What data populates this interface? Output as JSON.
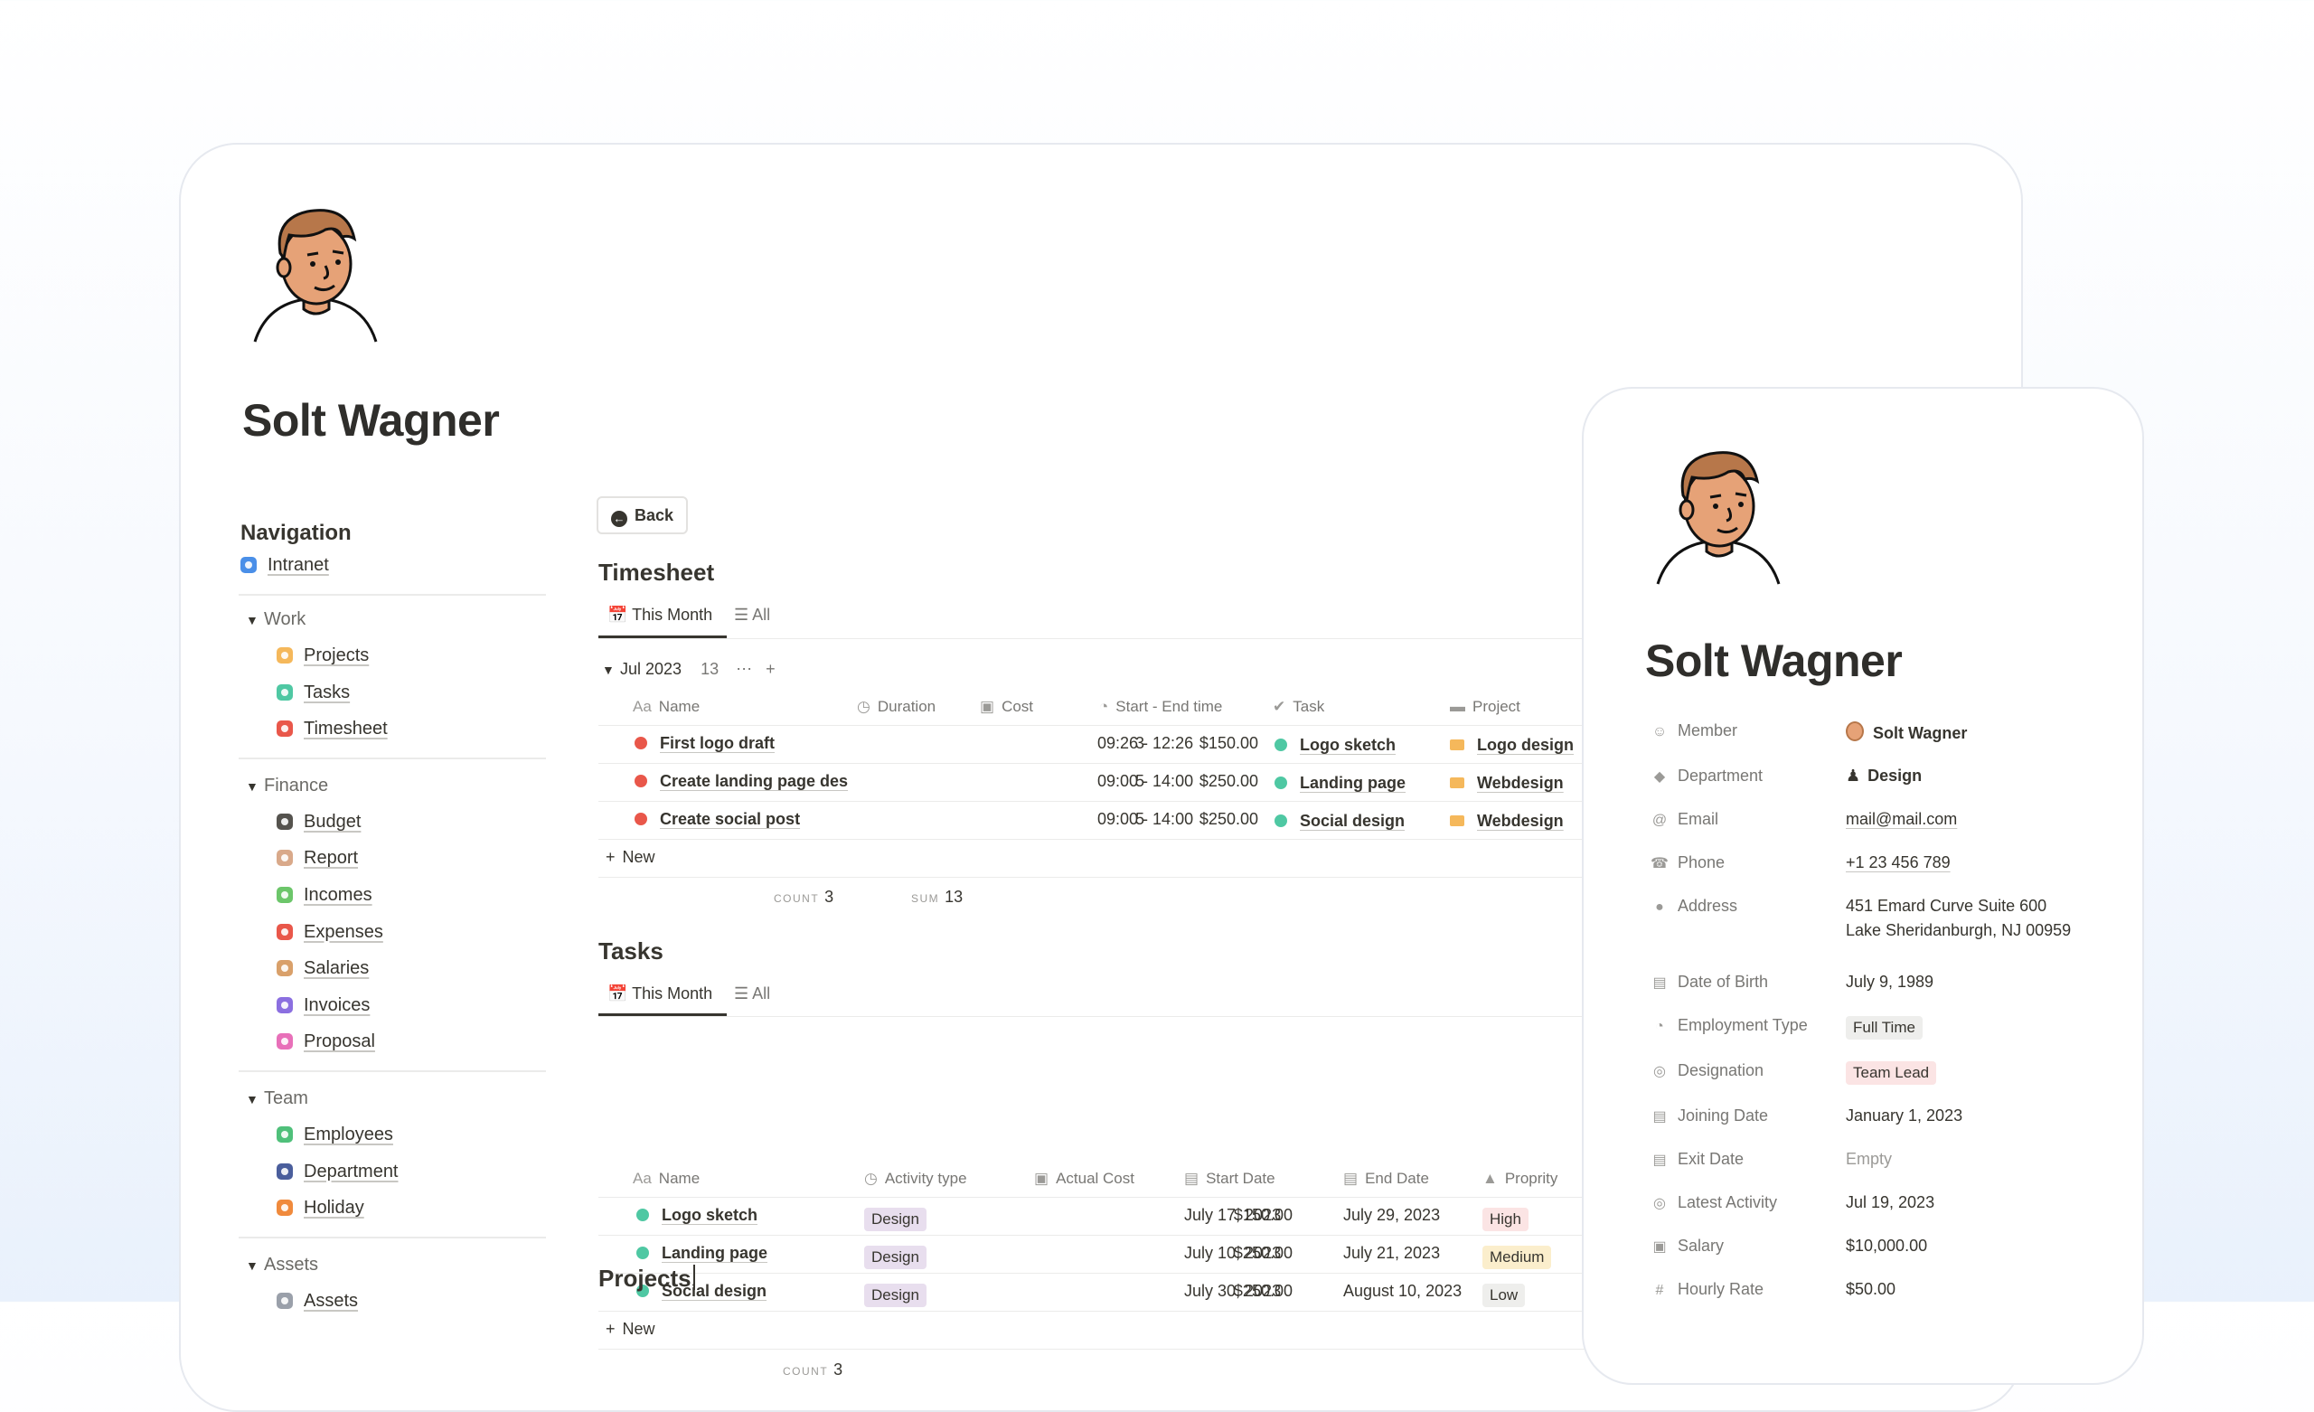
{
  "page": {
    "title": "Solt Wagner"
  },
  "navigation": {
    "heading": "Navigation",
    "intranet": "Intranet",
    "groups": [
      {
        "label": "Work",
        "items": [
          {
            "label": "Projects",
            "color": "#f5b85b"
          },
          {
            "label": "Tasks",
            "color": "#4fc8a3"
          },
          {
            "label": "Timesheet",
            "color": "#e9574a"
          }
        ]
      },
      {
        "label": "Finance",
        "items": [
          {
            "label": "Budget",
            "color": "#55534e"
          },
          {
            "label": "Report",
            "color": "#d9a98a"
          },
          {
            "label": "Incomes",
            "color": "#6cc66a"
          },
          {
            "label": "Expenses",
            "color": "#e9574a"
          },
          {
            "label": "Salaries",
            "color": "#d9a06a"
          },
          {
            "label": "Invoices",
            "color": "#8b6fe0"
          },
          {
            "label": "Proposal",
            "color": "#e870b9"
          }
        ]
      },
      {
        "label": "Team",
        "items": [
          {
            "label": "Employees",
            "color": "#4fc07a"
          },
          {
            "label": "Department",
            "color": "#4a5e9c"
          },
          {
            "label": "Holiday",
            "color": "#f08a3c"
          }
        ]
      },
      {
        "label": "Assets",
        "items": [
          {
            "label": "Assets",
            "color": "#9aa0aa"
          }
        ]
      }
    ]
  },
  "back_label": "Back",
  "timesheet": {
    "heading": "Timesheet",
    "tabs": [
      "This Month",
      "All"
    ],
    "group_label": "Jul 2023",
    "group_count": "13",
    "columns": [
      "Name",
      "Duration",
      "Cost",
      "Start - End time",
      "Task",
      "Project"
    ],
    "rows": [
      {
        "name": "First logo draft",
        "duration": "3",
        "cost": "$150.00",
        "time": "09:26 - 12:26",
        "task": "Logo sketch",
        "project": "Logo design"
      },
      {
        "name": "Create landing page des",
        "duration": "5",
        "cost": "$250.00",
        "time": "09:00 - 14:00",
        "task": "Landing page",
        "project": "Webdesign"
      },
      {
        "name": "Create social post",
        "duration": "5",
        "cost": "$250.00",
        "time": "09:00 - 14:00",
        "task": "Social design",
        "project": "Webdesign"
      }
    ],
    "new_label": "New",
    "count_label": "COUNT",
    "count_value": "3",
    "sum_label": "SUM",
    "sum_value": "13"
  },
  "tasks": {
    "heading": "Tasks",
    "tabs": [
      "This Month",
      "All"
    ],
    "columns": [
      "Name",
      "Activity type",
      "Actual Cost",
      "Start Date",
      "End Date",
      "Proprity"
    ],
    "rows": [
      {
        "name": "Logo sketch",
        "activity": "Design",
        "cost": "$150.00",
        "start": "July 17, 2023",
        "end": "July 29, 2023",
        "priority": "High"
      },
      {
        "name": "Landing page",
        "activity": "Design",
        "cost": "$250.00",
        "start": "July 10, 2023",
        "end": "July 21, 2023",
        "priority": "Medium"
      },
      {
        "name": "Social design",
        "activity": "Design",
        "cost": "$250.00",
        "start": "July 30, 2023",
        "end": "August 10, 2023",
        "priority": "Low"
      }
    ],
    "new_label": "New",
    "count_label": "COUNT",
    "count_value": "3"
  },
  "projects_heading": "Projects",
  "profile": {
    "title": "Solt Wagner",
    "props": [
      {
        "label": "Member",
        "value": "Solt Wagner"
      },
      {
        "label": "Department",
        "value": "Design"
      },
      {
        "label": "Email",
        "value": "mail@mail.com"
      },
      {
        "label": "Phone",
        "value": "+1 23 456 789"
      },
      {
        "label": "Address",
        "value": "451 Emard Curve Suite 600",
        "value2": "Lake Sheridanburgh, NJ 00959"
      },
      {
        "label": "Date of Birth",
        "value": "July 9, 1989"
      },
      {
        "label": "Employment Type",
        "value": "Full Time"
      },
      {
        "label": "Designation",
        "value": "Team Lead"
      },
      {
        "label": "Joining Date",
        "value": "January 1, 2023"
      },
      {
        "label": "Exit Date",
        "value": "Empty"
      },
      {
        "label": "Latest Activity",
        "value": "Jul 19, 2023"
      },
      {
        "label": "Salary",
        "value": "$10,000.00"
      },
      {
        "label": "Hourly Rate",
        "value": "$50.00"
      }
    ]
  },
  "colors": {
    "task_dot": "#4fc8a3",
    "timesheet_dot": "#e9574a",
    "project_folder": "#f5b85b",
    "pill_design": "#e8deee",
    "pill_high": "#fbe4e4",
    "pill_medium": "#fbeecc",
    "pill_low": "#eeeeec"
  }
}
